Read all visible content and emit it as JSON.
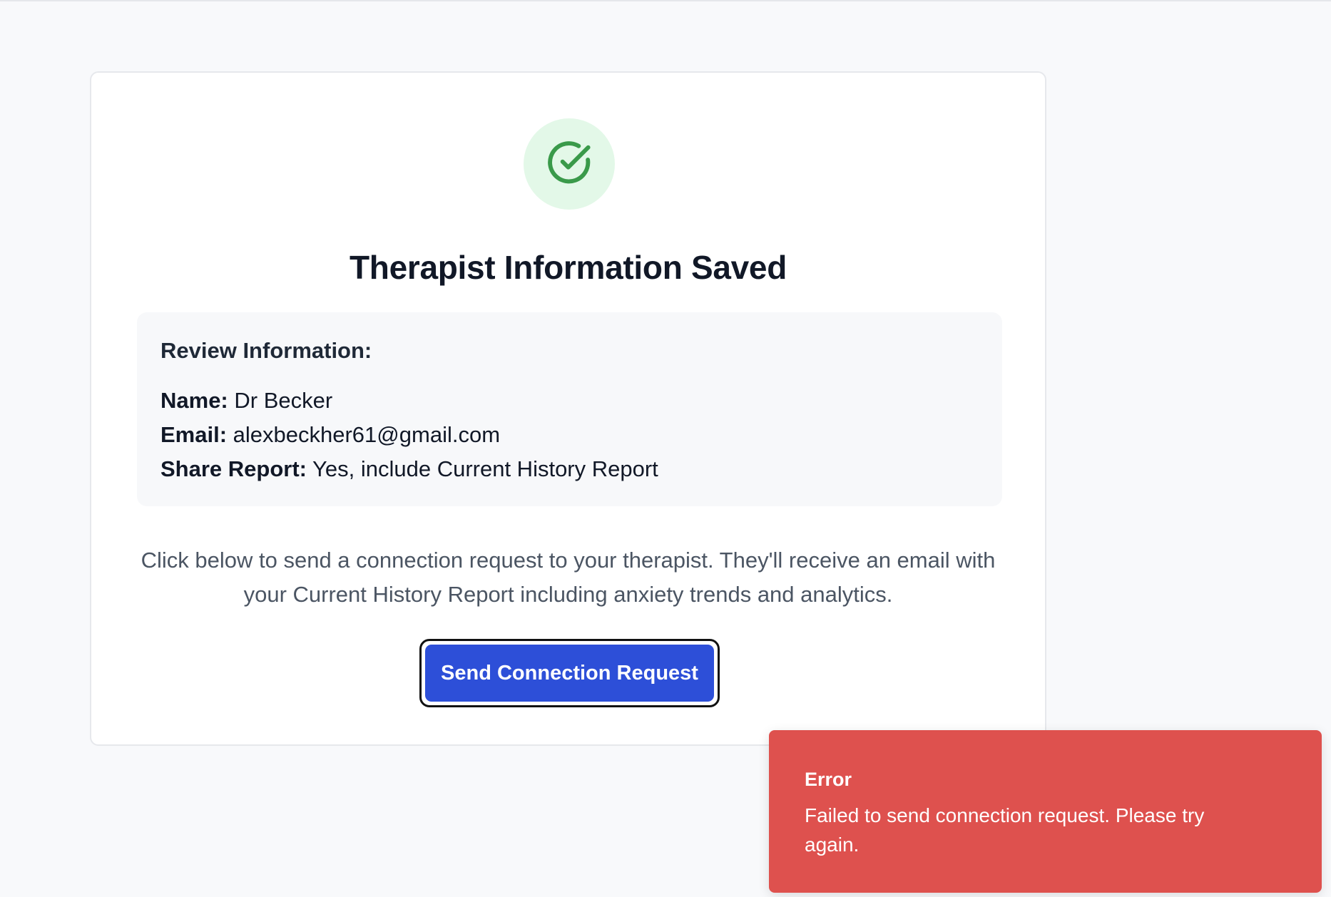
{
  "success": {
    "icon": "check-circle-icon",
    "title": "Therapist Information Saved"
  },
  "review": {
    "heading": "Review Information:",
    "name_label": "Name:",
    "name_value": "Dr Becker",
    "email_label": "Email:",
    "email_value": "alexbeckher61@gmail.com",
    "share_label": "Share Report:",
    "share_value": "Yes, include Current History Report"
  },
  "description": "Click below to send a connection request to your therapist. They'll receive an email with your Current History Report including anxiety trends and analytics.",
  "actions": {
    "send_label": "Send Connection Request"
  },
  "toast": {
    "title": "Error",
    "message": "Failed to send connection request. Please try again."
  },
  "colors": {
    "primary_button": "#2d4fd8",
    "success_bg": "#e3f8e8",
    "success_icon": "#3a9a4a",
    "error_bg": "#de514e"
  }
}
